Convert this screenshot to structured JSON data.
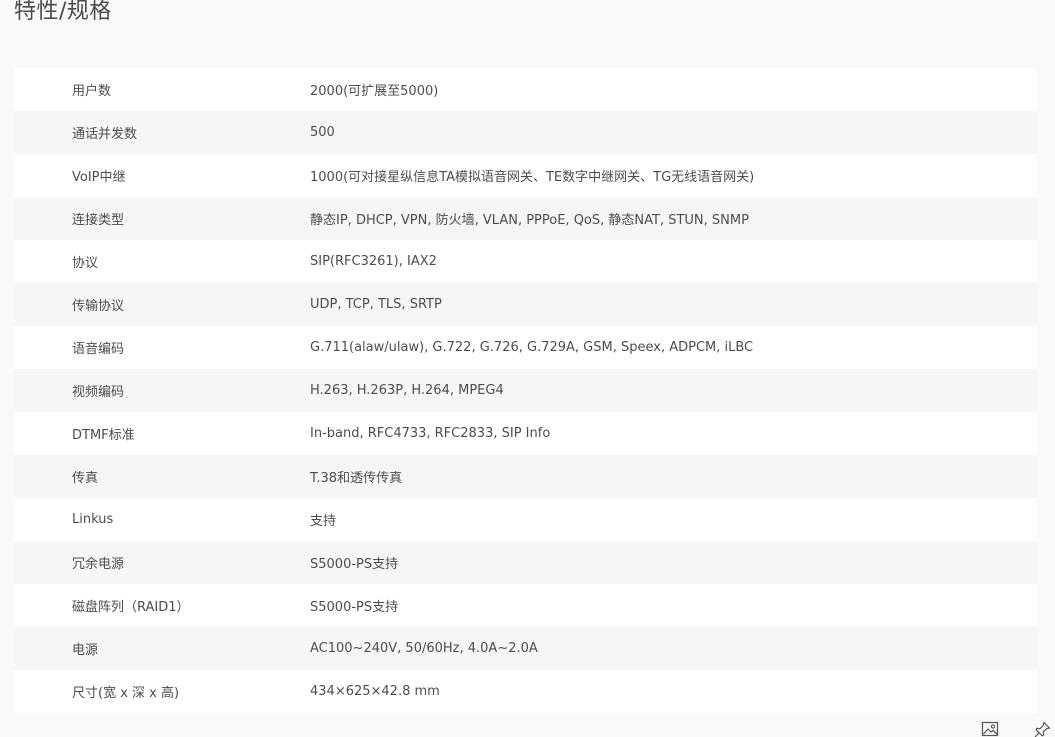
{
  "page": {
    "title": "特性/规格"
  },
  "specs": [
    {
      "label": "用户数",
      "value": "2000(可扩展至5000)"
    },
    {
      "label": "通话并发数",
      "value": "500"
    },
    {
      "label": "VoIP中继",
      "value": "1000(可对接星纵信息TA模拟语音网关、TE数字中继网关、TG无线语音网关)"
    },
    {
      "label": "连接类型",
      "value": "静态IP, DHCP, VPN, 防火墙, VLAN, PPPoE, QoS, 静态NAT, STUN, SNMP"
    },
    {
      "label": "协议",
      "value": "SIP(RFC3261), IAX2"
    },
    {
      "label": "传输协议",
      "value": "UDP, TCP, TLS, SRTP"
    },
    {
      "label": "语音编码",
      "value": "G.711(alaw/ulaw), G.722, G.726, G.729A, GSM, Speex, ADPCM, iLBC"
    },
    {
      "label": "视频编码",
      "value": "H.263, H.263P, H.264, MPEG4"
    },
    {
      "label": "DTMF标准",
      "value": "In-band, RFC4733, RFC2833, SIP Info"
    },
    {
      "label": "传真",
      "value": "T.38和透传传真"
    },
    {
      "label": "Linkus",
      "value": "支持"
    },
    {
      "label": "冗余电源",
      "value": "S5000-PS支持"
    },
    {
      "label": "磁盘阵列（RAID1）",
      "value": "S5000-PS支持"
    },
    {
      "label": "电源",
      "value": "AC100~240V, 50/60Hz, 4.0A~2.0A"
    },
    {
      "label": "尺寸(宽 x 深 x 高)",
      "value": "434×625×42.8 mm"
    }
  ],
  "tools": {
    "icons": [
      "image-icon",
      "pin-icon"
    ]
  }
}
